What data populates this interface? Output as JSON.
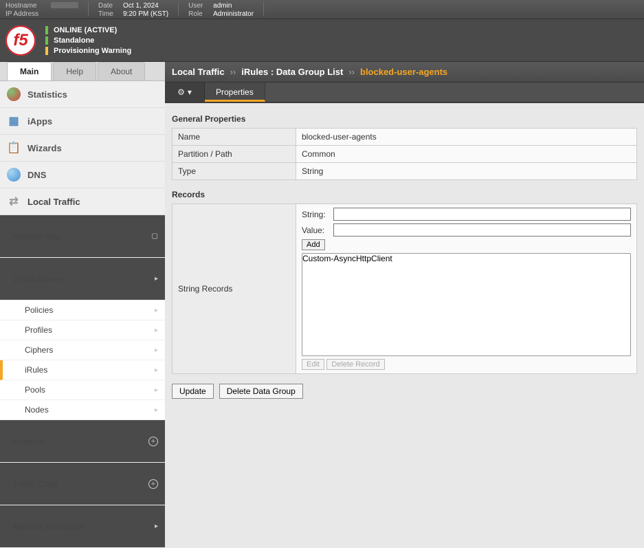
{
  "topbar": {
    "hostname_label": "Hostname",
    "ip_label": "IP Address",
    "date_label": "Date",
    "date_value": "Oct 1, 2024",
    "time_label": "Time",
    "time_value": "9:20 PM (KST)",
    "user_label": "User",
    "user_value": "admin",
    "role_label": "Role",
    "role_value": "Administrator"
  },
  "header": {
    "logo_text": "f5",
    "status1": "ONLINE (ACTIVE)",
    "status2": "Standalone",
    "status3": "Provisioning Warning"
  },
  "main_tabs": {
    "main": "Main",
    "help": "Help",
    "about": "About"
  },
  "nav": {
    "statistics": "Statistics",
    "iapps": "iApps",
    "wizards": "Wizards",
    "dns": "DNS",
    "local_traffic": "Local Traffic"
  },
  "subnav": {
    "network_map": "Network Map",
    "virtual_servers": "Virtual Servers",
    "policies": "Policies",
    "profiles": "Profiles",
    "ciphers": "Ciphers",
    "irules": "iRules",
    "pools": "Pools",
    "nodes": "Nodes",
    "monitors": "Monitors",
    "traffic_class": "Traffic Class",
    "address_translation": "Address Translation"
  },
  "breadcrumb": {
    "a": "Local Traffic",
    "b": "iRules : Data Group List",
    "current": "blocked-user-agents"
  },
  "subtabs": {
    "properties": "Properties"
  },
  "sections": {
    "general": "General Properties",
    "records": "Records"
  },
  "props": {
    "name_label": "Name",
    "name_value": "blocked-user-agents",
    "partition_label": "Partition / Path",
    "partition_value": "Common",
    "type_label": "Type",
    "type_value": "String"
  },
  "records": {
    "row_label": "String Records",
    "string_label": "String:",
    "value_label": "Value:",
    "add": "Add",
    "edit": "Edit",
    "delete": "Delete Record",
    "items": [
      "Custom-AsyncHttpClient"
    ]
  },
  "actions": {
    "update": "Update",
    "delete_group": "Delete Data Group"
  }
}
